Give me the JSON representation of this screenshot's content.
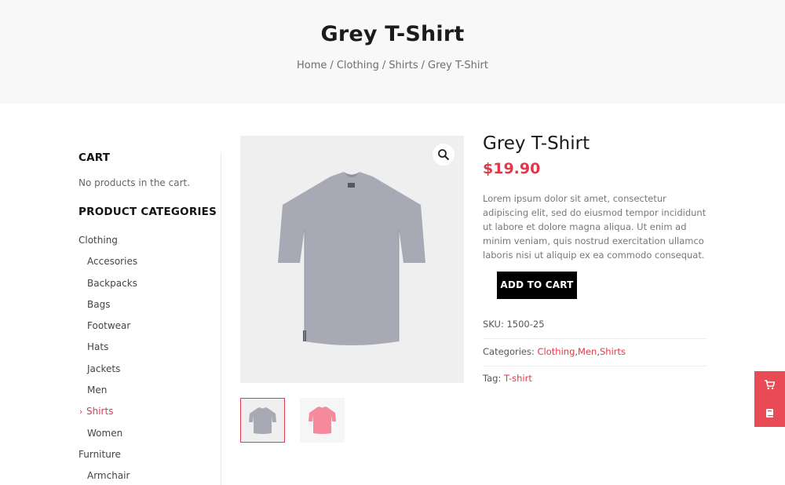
{
  "page": {
    "title": "Grey T-Shirt",
    "breadcrumb": [
      {
        "label": "Home"
      },
      {
        "label": "Clothing"
      },
      {
        "label": "Shirts"
      },
      {
        "label": "Grey T-Shirt"
      }
    ],
    "breadcrumb_separator": "/"
  },
  "sidebar": {
    "cart_title": "CART",
    "cart_empty": "No products in the cart.",
    "categories_title": "PRODUCT CATEGORIES",
    "categories": [
      {
        "label": "Clothing",
        "level": 0
      },
      {
        "label": "Accesories",
        "level": 1
      },
      {
        "label": "Backpacks",
        "level": 1
      },
      {
        "label": "Bags",
        "level": 1
      },
      {
        "label": "Footwear",
        "level": 1
      },
      {
        "label": "Hats",
        "level": 1
      },
      {
        "label": "Jackets",
        "level": 1
      },
      {
        "label": "Men",
        "level": 1
      },
      {
        "label": "Shirts",
        "level": 1,
        "active": true
      },
      {
        "label": "Women",
        "level": 1
      },
      {
        "label": "Furniture",
        "level": 0
      },
      {
        "label": "Armchair",
        "level": 1
      }
    ]
  },
  "product": {
    "title": "Grey T-Shirt",
    "price": "$19.90",
    "description": "Lorem ipsum dolor sit amet, consectetur adipiscing elit, sed do eiusmod tempor incididunt ut labore et dolore magna aliqua. Ut enim ad minim veniam, quis nostrud exercitation ullamco laboris nisi ut aliquip ex ea commodo consequat.",
    "add_to_cart": "ADD TO CART",
    "sku_label": "SKU:",
    "sku": "1500-25",
    "categories_label": "Categories:",
    "categories": [
      "Clothing",
      "Men",
      "Shirts"
    ],
    "tag_label": "Tag:",
    "tag": "T-shirt",
    "thumbnails": [
      {
        "name": "grey-tshirt",
        "selected": true
      },
      {
        "name": "pink-tshirt",
        "selected": false
      }
    ]
  },
  "icons": {
    "zoom": "magnifier-icon",
    "float_cart": "cart-icon",
    "float_book": "book-icon"
  },
  "colors": {
    "accent": "#e2394a",
    "hero_bg": "#f8f8f8",
    "button_bg": "#000000",
    "float_bar": "#e94b56",
    "tshirt_grey": "#a7aab4",
    "tshirt_pink": "#f48a9c"
  }
}
